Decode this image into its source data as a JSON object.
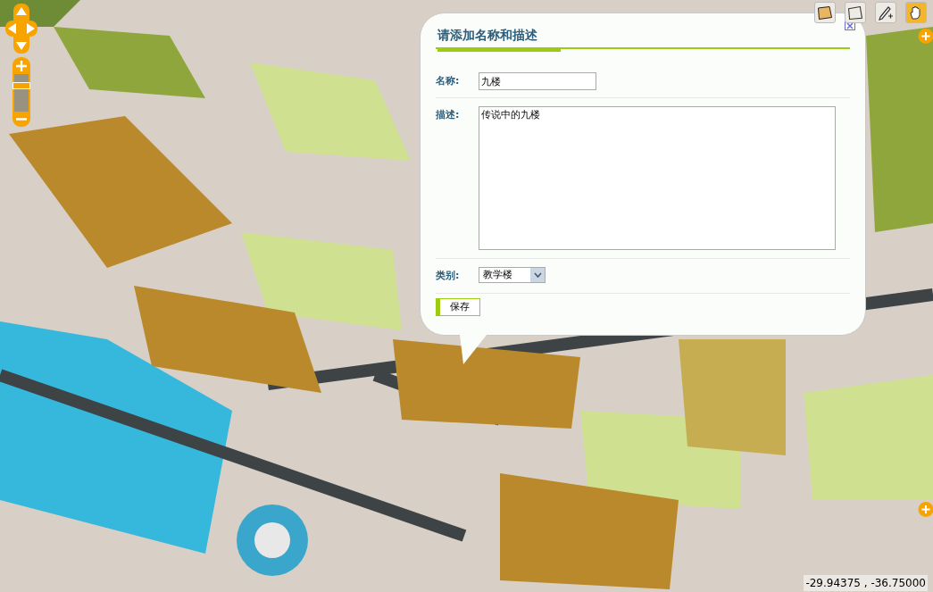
{
  "popup": {
    "title": "请添加名称和描述",
    "fields": [
      {
        "kind": "input",
        "label": "名称:",
        "value": "九楼"
      },
      {
        "kind": "textarea",
        "label": "描述:",
        "value": "传说中的九楼"
      },
      {
        "kind": "select",
        "label": "类别:",
        "value": "教学楼"
      }
    ],
    "save_button": "保存"
  },
  "tools": [
    {
      "kind": "polygon-filled",
      "selected": false
    },
    {
      "kind": "polygon",
      "selected": false
    },
    {
      "kind": "pencil",
      "selected": false
    },
    {
      "kind": "hand",
      "selected": true
    }
  ],
  "zoom": {
    "level": 0.75
  },
  "coordinates": "-29.94375 , -36.75000"
}
